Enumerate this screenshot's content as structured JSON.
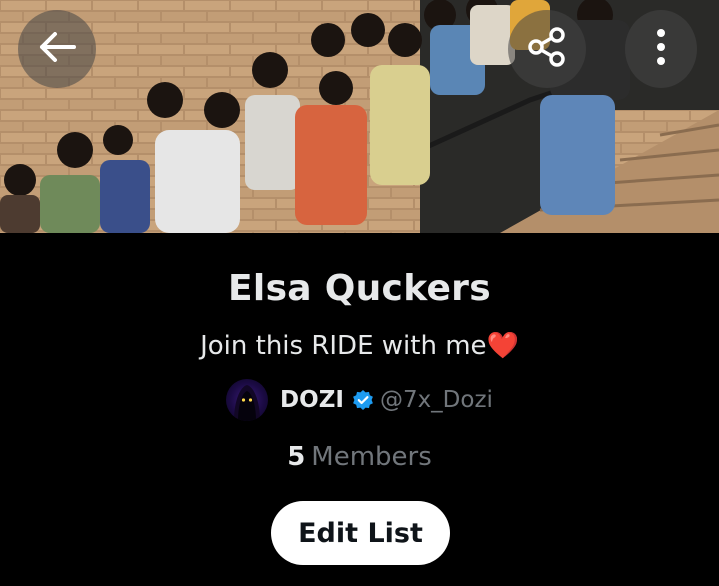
{
  "list": {
    "name": "Elsa Quckers",
    "description": "Join this RIDE with me",
    "description_emoji": "❤️"
  },
  "owner": {
    "display_name": "DOZI",
    "handle": "@7x_Dozi",
    "verified": true
  },
  "members": {
    "count": "5",
    "label": "Members"
  },
  "actions": {
    "edit_label": "Edit List"
  },
  "icons": {
    "back": "arrow-left-icon",
    "share": "share-icon",
    "more": "more-vertical-icon",
    "verified": "verified-badge-icon"
  },
  "colors": {
    "background": "#000000",
    "primary_text": "#e7e9ea",
    "secondary_text": "#71767b",
    "verified_blue": "#1d9bf0",
    "button_bg": "#ffffff",
    "button_text": "#0f1419"
  }
}
